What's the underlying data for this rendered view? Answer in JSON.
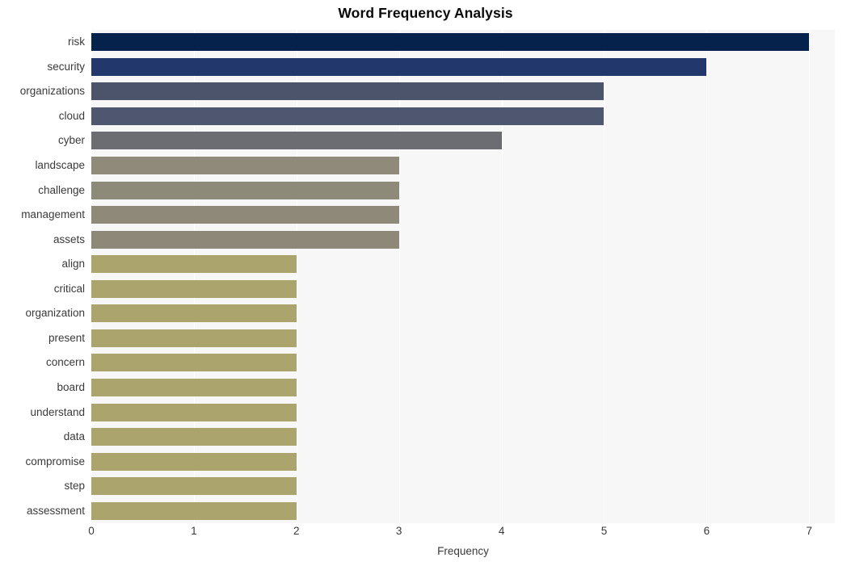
{
  "chart_data": {
    "type": "bar",
    "orientation": "horizontal",
    "title": "Word Frequency Analysis",
    "xlabel": "Frequency",
    "ylabel": "",
    "xlim": [
      0,
      7.25
    ],
    "xticks": [
      0,
      1,
      2,
      3,
      4,
      5,
      6,
      7
    ],
    "xtick_labels": [
      "0",
      "1",
      "2",
      "3",
      "4",
      "5",
      "6",
      "7"
    ],
    "grid": true,
    "grid_axis": "x",
    "grid_color": "#ffffff",
    "plot_background": "#f7f7f7",
    "figure_background": "#ffffff",
    "legend": false,
    "categories": [
      "risk",
      "security",
      "organizations",
      "cloud",
      "cyber",
      "landscape",
      "challenge",
      "management",
      "assets",
      "align",
      "critical",
      "organization",
      "present",
      "concern",
      "board",
      "understand",
      "data",
      "compromise",
      "step",
      "assessment"
    ],
    "values": [
      7,
      6,
      5,
      5,
      4,
      3,
      3,
      3,
      3,
      2,
      2,
      2,
      2,
      2,
      2,
      2,
      2,
      2,
      2,
      2
    ],
    "bar_colors": [
      "#04224c",
      "#22386c",
      "#4c546b",
      "#4e5670",
      "#6b6d72",
      "#8f8a7a",
      "#8e8a79",
      "#8e8979",
      "#8d8878",
      "#aba46d",
      "#aba46d",
      "#aba46d",
      "#aba46d",
      "#aba46d",
      "#aba46d",
      "#aba46d",
      "#aba46d",
      "#aba46d",
      "#aba46d",
      "#aba46d"
    ]
  }
}
